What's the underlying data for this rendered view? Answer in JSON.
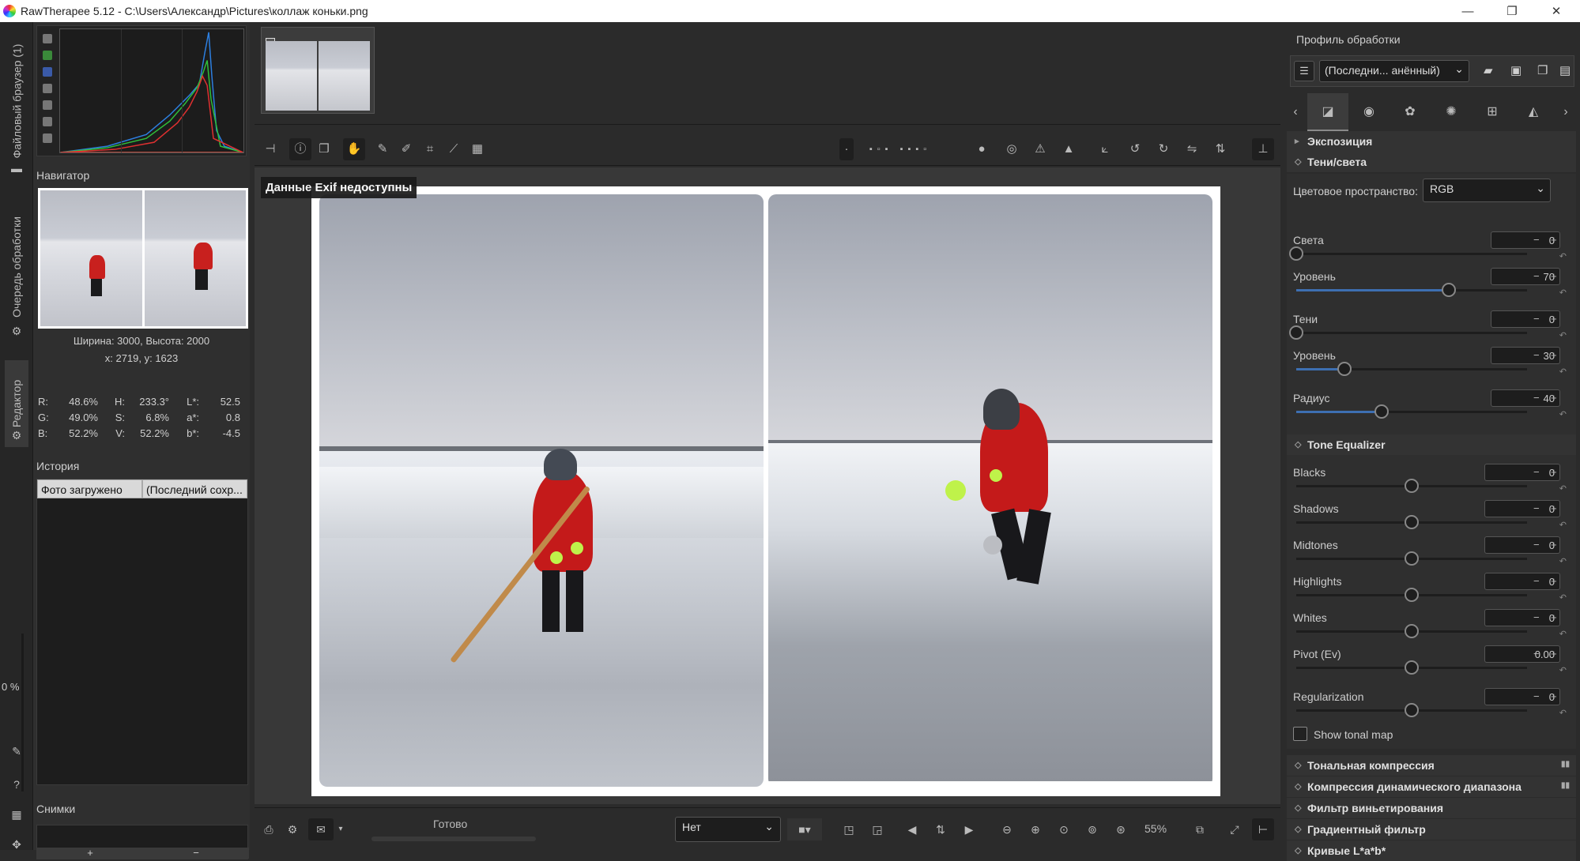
{
  "window": {
    "title": "RawTherapee 5.12 - C:\\Users\\Александр\\Pictures\\коллаж коньки.png",
    "minimize": "—",
    "restore": "❐",
    "close": "✕"
  },
  "left_strip": {
    "tabs": [
      "Файловый браузер (1)",
      "Очередь обработки",
      "Редактор"
    ],
    "zoom_percent": "0 %"
  },
  "navigator": {
    "title": "Навигатор",
    "size_text": "Ширина: 3000, Высота: 2000",
    "coords_text": "x: 2719, y: 1623",
    "pixels": [
      [
        "R:",
        "48.6%",
        "H:",
        "233.3°",
        "L*:",
        "52.5"
      ],
      [
        "G:",
        "49.0%",
        "S:",
        "6.8%",
        "a*:",
        "0.8"
      ],
      [
        "B:",
        "52.2%",
        "V:",
        "52.2%",
        "b*:",
        "-4.5"
      ]
    ]
  },
  "history": {
    "title": "История",
    "row": [
      "Фото загружено",
      "(Последний сохр..."
    ]
  },
  "snapshots": {
    "title": "Снимки",
    "add": "+",
    "remove": "−"
  },
  "viewer": {
    "exif_text": "Данные Exif недоступны"
  },
  "statusbar": {
    "status": "Готово",
    "preset_value": "Нет",
    "zoom": "55%"
  },
  "profile": {
    "title": "Профиль обработки",
    "value": "(Последни... анённый)"
  },
  "sections": {
    "exposure": "Экспозиция",
    "shadows_highlights": "Тени/света",
    "tone_equalizer": "Tone Equalizer",
    "tone_compression": "Тональная компрессия",
    "dynamic_range": "Компрессия динамического диапазона",
    "vignetting": "Фильтр виньетирования",
    "gradient": "Градиентный фильтр",
    "lab_curves": "Кривые L*a*b*"
  },
  "shadows_highlights": {
    "color_space_label": "Цветовое пространство:",
    "color_space_value": "RGB",
    "sliders": [
      {
        "label": "Света",
        "value": "0",
        "fraction": 0.0
      },
      {
        "label": "Уровень",
        "value": "70",
        "fraction": 0.66
      },
      {
        "label": "Тени",
        "value": "0",
        "fraction": 0.0
      },
      {
        "label": "Уровень",
        "value": "30",
        "fraction": 0.21
      },
      {
        "label": "Радиус",
        "value": "40",
        "fraction": 0.37
      }
    ]
  },
  "tone_equalizer": {
    "sliders": [
      {
        "label": "Blacks",
        "value": "0",
        "fraction": 0.5
      },
      {
        "label": "Shadows",
        "value": "0",
        "fraction": 0.5
      },
      {
        "label": "Midtones",
        "value": "0",
        "fraction": 0.5
      },
      {
        "label": "Highlights",
        "value": "0",
        "fraction": 0.5
      },
      {
        "label": "Whites",
        "value": "0",
        "fraction": 0.5
      },
      {
        "label": "Pivot (Ev)",
        "value": "0.00",
        "fraction": 0.5
      },
      {
        "label": "Regularization",
        "value": "0",
        "fraction": 0.5
      }
    ],
    "show_tonal_map": "Show tonal map"
  },
  "colors": {
    "accent": "#3d6fb2",
    "coat": "#c41a1a"
  }
}
